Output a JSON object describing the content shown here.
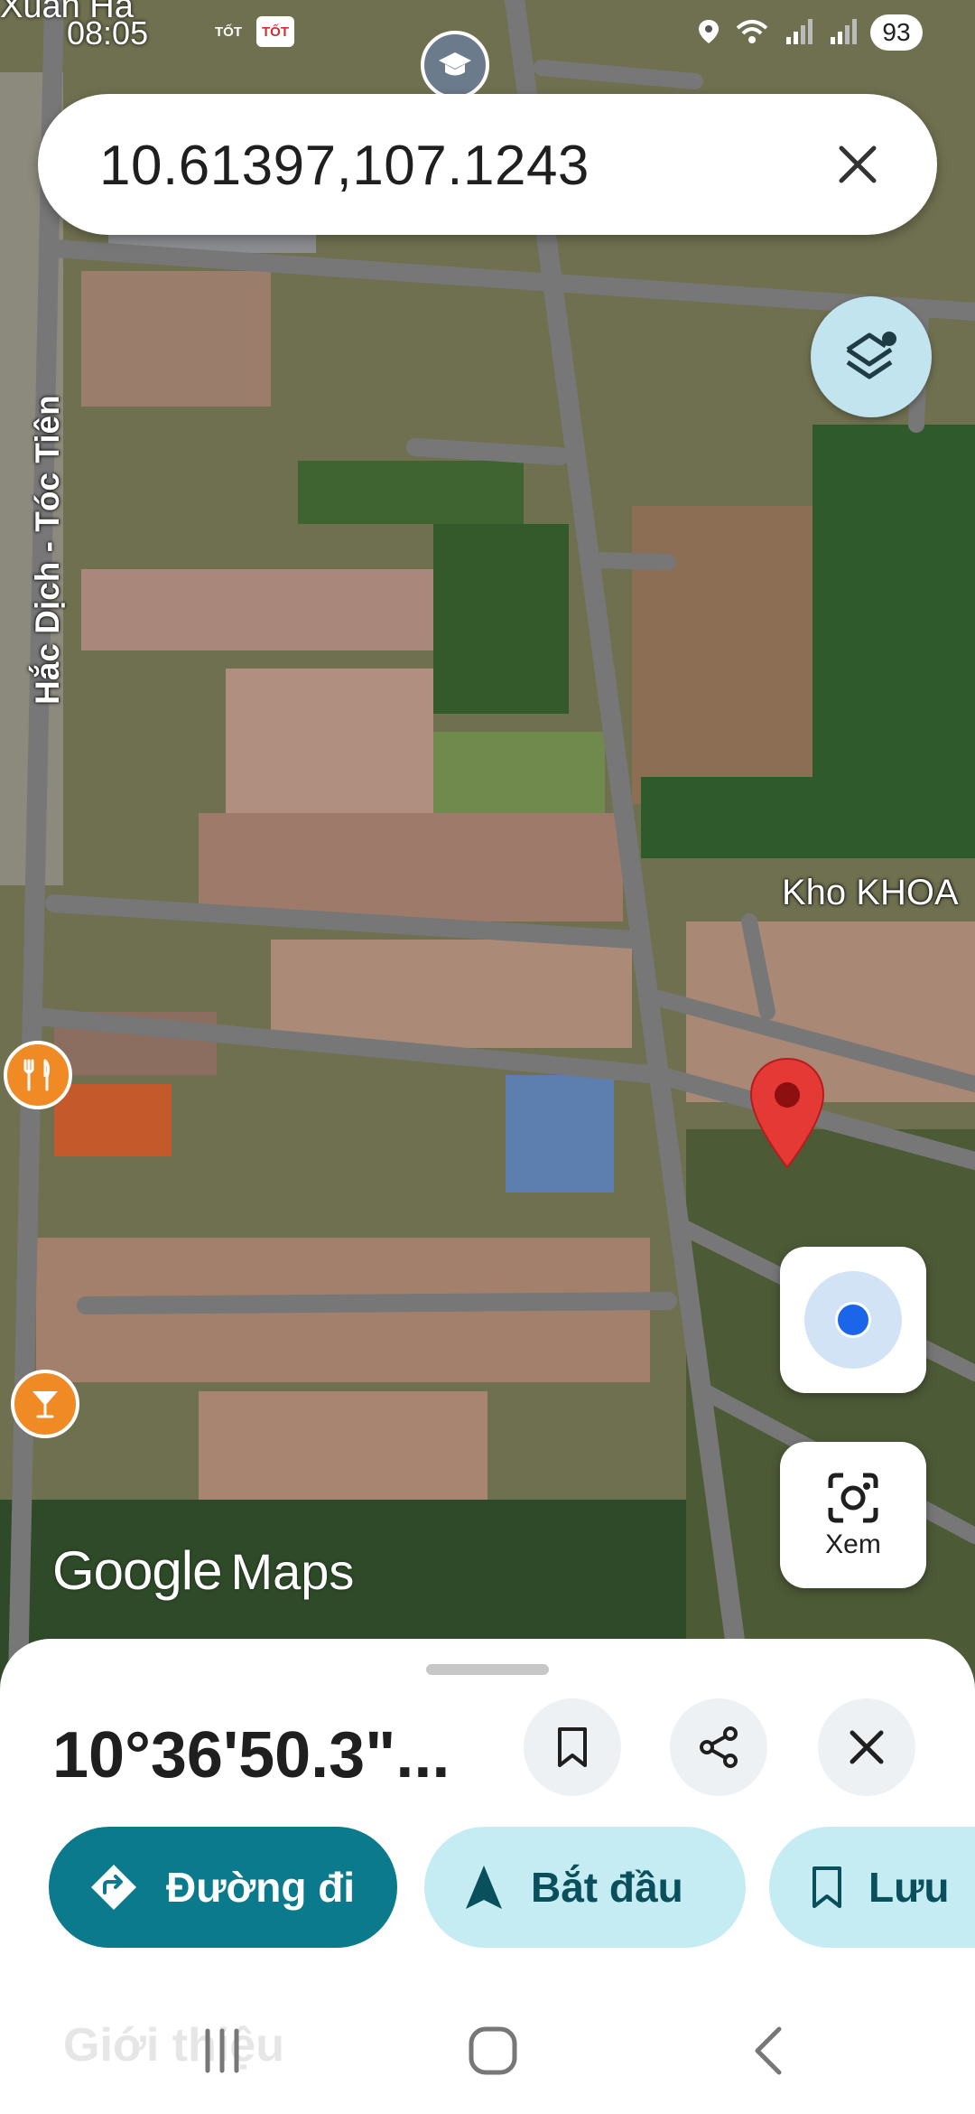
{
  "status_bar": {
    "place_fragment": "Xuân Hà",
    "time": "08:05",
    "notification_badges": [
      "TỐT",
      "TỐT"
    ],
    "battery": "93"
  },
  "search": {
    "query": "10.61397,107.1243"
  },
  "map": {
    "road_label": "Hắc Dịch - Tóc Tiên",
    "place_label": "Kho KHOA",
    "logo": {
      "google": "Google",
      "maps": "Maps"
    }
  },
  "icons": {
    "school_pin": "school-icon",
    "layers": "layers-icon",
    "restaurant_poi": "restaurant-icon",
    "bar_poi": "bar-icon",
    "location_pin": "red-pin-icon",
    "my_location": "my-location-icon",
    "lens": "lens-icon"
  },
  "lens_button": {
    "label": "Xem"
  },
  "sheet": {
    "title": "10°36'50.3\"...",
    "actions": [
      {
        "label": "Đường đi",
        "icon": "directions-icon"
      },
      {
        "label": "Bắt đầu",
        "icon": "navigation-arrow-icon"
      },
      {
        "label": "Lưu",
        "icon": "bookmark-icon"
      }
    ],
    "section_header": "Giới thiệu"
  },
  "colors": {
    "primary_teal": "#0b7a8c",
    "light_teal": "#c5ecf3",
    "pin_red": "#e53935",
    "poi_orange": "#f08a24",
    "location_blue": "#1a65e8"
  }
}
